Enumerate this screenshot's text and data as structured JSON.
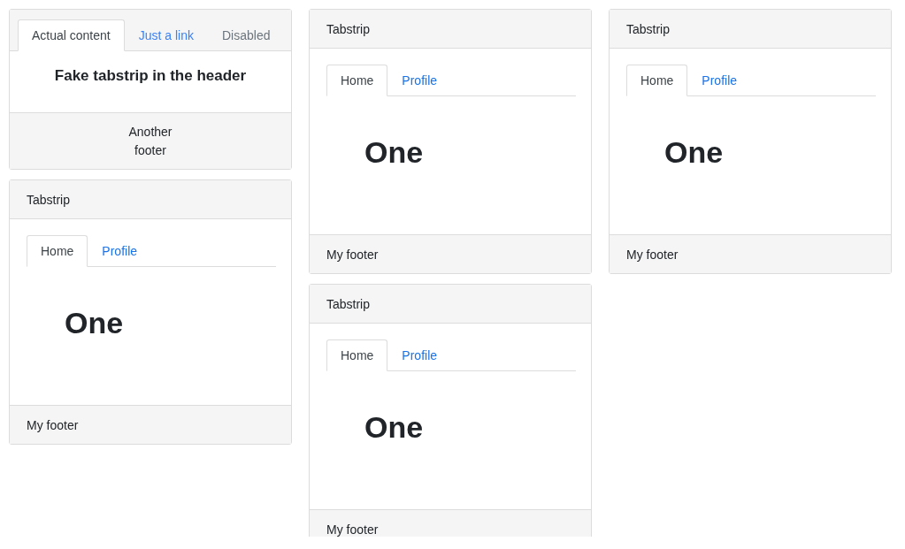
{
  "columns": [
    {
      "cards": [
        {
          "kind": "header-tabs",
          "tabs": [
            {
              "label": "Actual content",
              "selected": true,
              "disabled": false
            },
            {
              "label": "Just a link",
              "selected": false,
              "disabled": false
            },
            {
              "label": "Disabled",
              "selected": false,
              "disabled": true
            }
          ],
          "body_title": "Fake tabstrip in the header",
          "footer": "Another footer"
        },
        {
          "kind": "tabstrip",
          "header": "Tabstrip",
          "tabs": [
            {
              "label": "Home",
              "selected": true
            },
            {
              "label": "Profile",
              "selected": false
            }
          ],
          "content": "One",
          "footer": "My footer"
        }
      ]
    },
    {
      "cards": [
        {
          "kind": "tabstrip",
          "header": "Tabstrip",
          "tabs": [
            {
              "label": "Home",
              "selected": true
            },
            {
              "label": "Profile",
              "selected": false
            }
          ],
          "content": "One",
          "footer": "My footer"
        },
        {
          "kind": "tabstrip",
          "header": "Tabstrip",
          "tabs": [
            {
              "label": "Home",
              "selected": true
            },
            {
              "label": "Profile",
              "selected": false
            }
          ],
          "content": "One",
          "footer": "My footer"
        }
      ]
    },
    {
      "cards": [
        {
          "kind": "tabstrip",
          "header": "Tabstrip",
          "tabs": [
            {
              "label": "Home",
              "selected": true
            },
            {
              "label": "Profile",
              "selected": false
            }
          ],
          "content": "One",
          "footer": "My footer"
        }
      ]
    }
  ]
}
